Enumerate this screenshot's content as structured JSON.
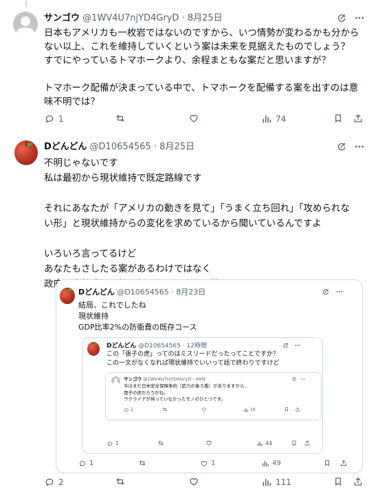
{
  "tweet1": {
    "name": "サンゴウ",
    "handle": "@1WV4U7njYD4GryD",
    "sep": "·",
    "date": "8月25日",
    "text": "日本もアメリカも一枚岩ではないのですから、いつ情勢が変わるかも分から\nない以上、これを維持していくという案は未来を見据えたものでしょう？\nすでにやっているトマホークより、余程まともな案だと思いますが？\n\nトマホーク配備が決まっている中で、トマホークを配備する案を出すのは意\n味不明では？",
    "reply_count": "1",
    "repost_count": "",
    "like_count": "",
    "view_count": "74"
  },
  "tweet2": {
    "name": "Dどんどん",
    "handle": "@D10654565",
    "sep": "·",
    "date": "8月25日",
    "text": "不明じゃないです\n私は最初から現状維持で既定路線です\n\nそれにあなたが「アメリカの動きを見て」「うまく立ち回れ」「攻められな\nい形」と現状維持からの変化を求めているから聞いているんですよ\n\nいろいろ言ってるけど\nあなたもさしたる案があるわけではなく\n政府の方針通りで特に何もないんでしょ笑",
    "reply_count": "2",
    "repost_count": "",
    "like_count": "",
    "view_count": "111"
  },
  "quote1": {
    "name": "Dどんどん",
    "handle": "@D10654565",
    "sep": "·",
    "date": "8月23日",
    "text": "結局、これでしたね\n現状維持\nGDP比率2%の防衛費の既存コース",
    "reply_count": "1",
    "repost_count": "",
    "like_count": "1",
    "view_count": "49"
  },
  "quote2": {
    "name": "Dどんどん",
    "handle": "@D10654565",
    "sep": "·",
    "date": "12時間",
    "text": "この「張子の虎」ってのはミスリードだったってことですか？\nこの一文がなくなれば現状維持でいいって話で終わりですけど",
    "reply_count": "1",
    "repost_count": "",
    "like_count": "",
    "view_count": "44"
  },
  "quote3": {
    "name": "サンゴウ",
    "handle": "@1WV4U7njYD4GryD",
    "sep": "·",
    "date": "49分",
    "text": "今はまだ日米安全保障条約（武力の後ろ盾）がありますから、\n張子の虎だろうがね。\nウクライナが持っていなかったモノのひとつです。",
    "reply_count": "2",
    "repost_count": "",
    "like_count": "",
    "view_count": "16"
  },
  "icons": {
    "reply": "reply-icon",
    "repost": "repost-icon",
    "like": "like-icon",
    "views": "views-icon",
    "bookmark": "bookmark-icon",
    "share": "share-icon",
    "grok": "grok-icon",
    "more": "more-icon"
  },
  "colors": {
    "text": "#0f1419",
    "secondary": "#536471",
    "border": "#cfd9de",
    "background": "#ffffff"
  }
}
